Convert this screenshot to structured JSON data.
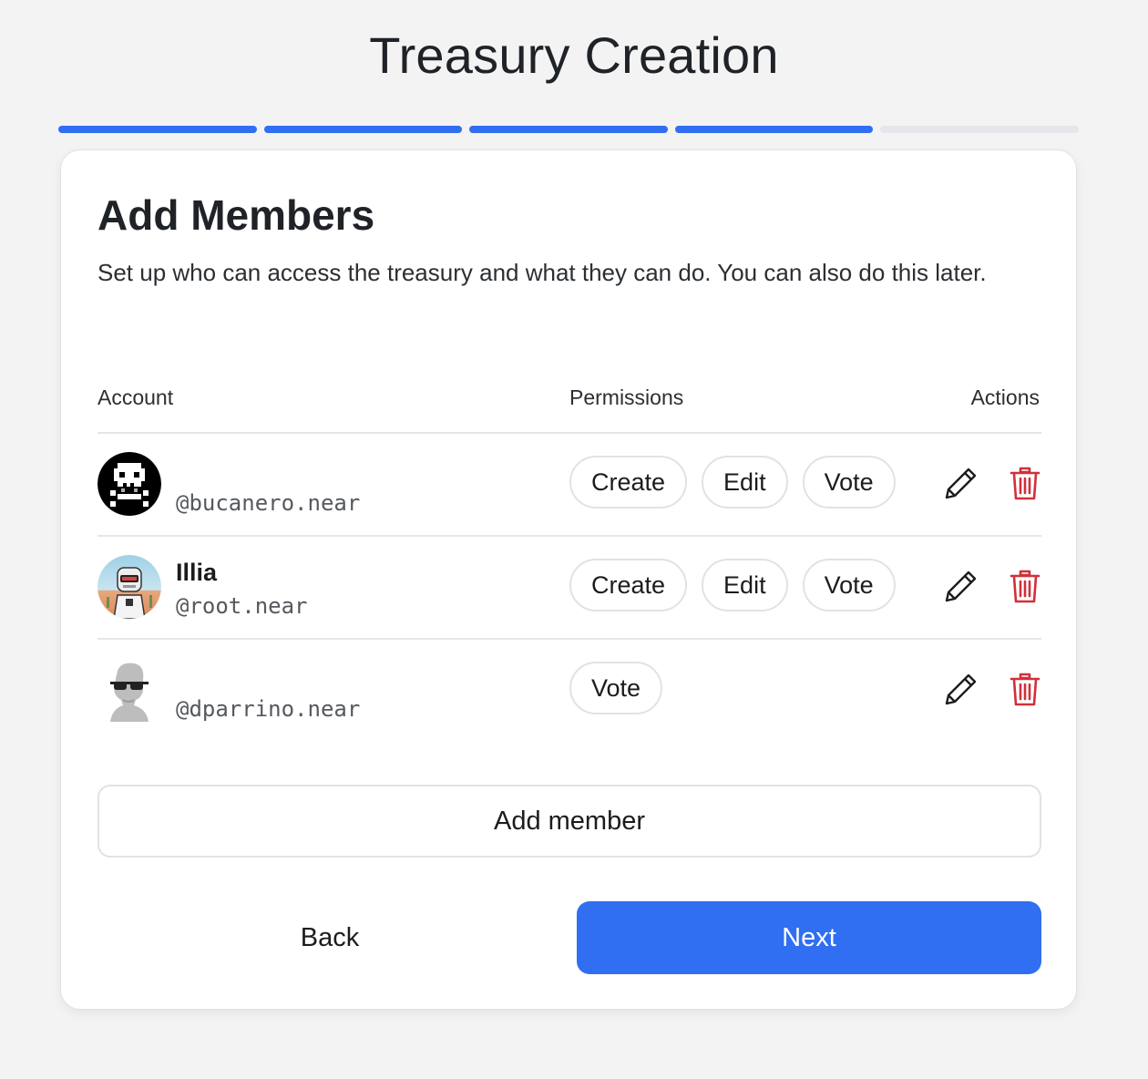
{
  "header": {
    "title": "Treasury Creation"
  },
  "progress": {
    "total_steps": 5,
    "completed_steps": 4,
    "accent": "#306ef2"
  },
  "card": {
    "title": "Add Members",
    "description": "Set up who can access the treasury and what they can do. You can also do this later."
  },
  "table": {
    "columns": {
      "account": "Account",
      "permissions": "Permissions",
      "actions": "Actions"
    },
    "rows": [
      {
        "name": "",
        "handle": "@bucanero.near",
        "avatar": "pixel-skull-avatar",
        "permissions": [
          "Create",
          "Edit",
          "Vote"
        ]
      },
      {
        "name": "Illia",
        "handle": "@root.near",
        "avatar": "robot-avatar",
        "permissions": [
          "Create",
          "Edit",
          "Vote"
        ]
      },
      {
        "name": "",
        "handle": "@dparrino.near",
        "avatar": "sunglasses-person-avatar",
        "permissions": [
          "Vote"
        ]
      }
    ],
    "edit_icon": "pencil-icon",
    "delete_icon": "trash-icon",
    "delete_color": "#d1303a"
  },
  "buttons": {
    "add_member": "Add member",
    "back": "Back",
    "next": "Next"
  }
}
